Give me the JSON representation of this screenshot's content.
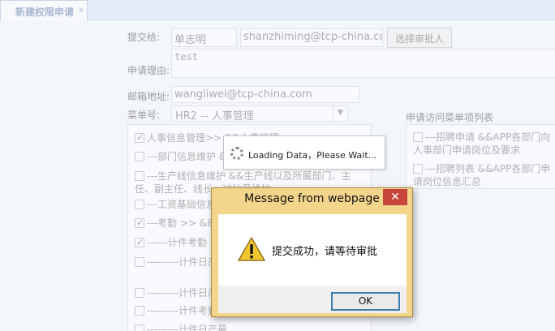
{
  "tab": {
    "title": "新建权限申请",
    "close": "x"
  },
  "form": {
    "submitter_label": "提交给:",
    "submitter_name": "单志明",
    "submitter_email": "shanzhiming@tcp-china.com",
    "choose_approver": "选择审批人",
    "reason_label": "申请理由:",
    "reason_value": "test",
    "email_label": "邮箱地址:",
    "email_value": "wangliwei@tcp-china.com",
    "menu_label": "菜单号:",
    "menu_value": "HR2 -- 人事管理",
    "right_panel_title": "申请访问菜单项列表",
    "left_items": [
      {
        "text": "人事信息管理>> &&人事管理",
        "checked": true
      },
      {
        "text": "---部门信息维护 &&部门在职人员信息维护",
        "checked": false
      },
      {
        "text": "---生产线信息维护 &&生产线以及所属部门、主任、副主任、线长、过站员维护",
        "checked": false
      },
      {
        "text": "---工资基础信息",
        "checked": false
      },
      {
        "text": "---考勤 >> &&考勤",
        "checked": true
      },
      {
        "text": "------计件考勤 >",
        "checked": true
      },
      {
        "text": "---------计件日产量录入",
        "checked": false
      },
      {
        "text": "---------计件日产",
        "checked": false
      },
      {
        "text": "---------计件考勤",
        "checked": false
      },
      {
        "text": "---------计件日产量",
        "checked": false
      }
    ],
    "right_items": [
      {
        "text": "---招聘申请 &&APP各部门向人事部门申请岗位及要求",
        "checked": false
      },
      {
        "text": "---招聘列表 &&APP各部门申请岗位信息汇总",
        "checked": false
      }
    ]
  },
  "loading": {
    "text": "Loading Data，Please Wait..."
  },
  "dialog": {
    "title": "Message from webpage",
    "close": "✕",
    "message": "提交成功，请等待审批",
    "ok": "OK",
    "icon": "warning-icon"
  },
  "colors": {
    "dialog_frame": "#f4d58c",
    "close_button": "#c7453a",
    "tab_text": "#a9b8d2"
  }
}
